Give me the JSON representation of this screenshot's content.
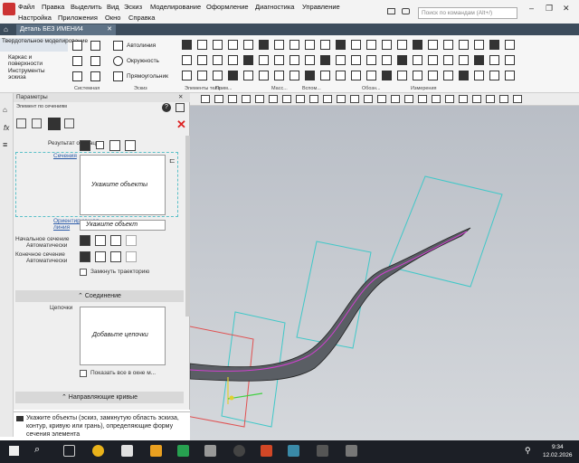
{
  "menu": {
    "row1": [
      "Файл",
      "Правка",
      "Выделить",
      "Вид",
      "Эскиз",
      "Моделирование",
      "Оформление",
      "Диагностика",
      "Управление"
    ],
    "row2": [
      "Настройка",
      "Приложения",
      "Окно",
      "Справка"
    ]
  },
  "search": {
    "placeholder": "Поиск по командам (Alt+/)"
  },
  "doc_tab": {
    "label": "Деталь БЕЗ ИМЕНИ4"
  },
  "ribbon": {
    "modes": [
      "Твердотельное моделирование",
      "Каркас и поверхности",
      "Инструменты эскиза"
    ],
    "tools": [
      "Автолиния",
      "Окружность",
      "Прямоугольник"
    ],
    "groups": [
      "Системная",
      "Эскиз",
      "Элементы тела",
      "Прим...",
      "Масс...",
      "Вспом...",
      "Обозн...",
      "Измерения"
    ]
  },
  "panel": {
    "title": "Параметры",
    "subtitle": "Элемент по сечениям",
    "result_label": "Результат операции",
    "sections_link": "Сечения",
    "sections_box": "Укажите объекты",
    "guide_link": "Ориентирующая линия",
    "guide_value": "Укажите объект",
    "start_section": "Начальное сечение",
    "end_section": "Конечное сечение",
    "auto": "Автоматически",
    "close_traj": "Замкнуть траекторию",
    "connection_header": "Соединение",
    "chains_label": "Цепочки",
    "chains_box": "Добавьте цепочки",
    "show_all": "Показать все в окне м...",
    "guide_curves_header": "Направляющие кривые",
    "hint": "Укажите объекты (эскиз, замкнутую область эскиза, контур, кривую или грань), определяющие форму сечения элемента"
  },
  "taskbar": {
    "time": "9:34",
    "date": "12.02.2026"
  },
  "colors": {
    "tab_bar": "#3c4c5c",
    "taskbar": "#1c1f26",
    "section_frames": "#40c8c8",
    "spine": "#d040d0"
  }
}
